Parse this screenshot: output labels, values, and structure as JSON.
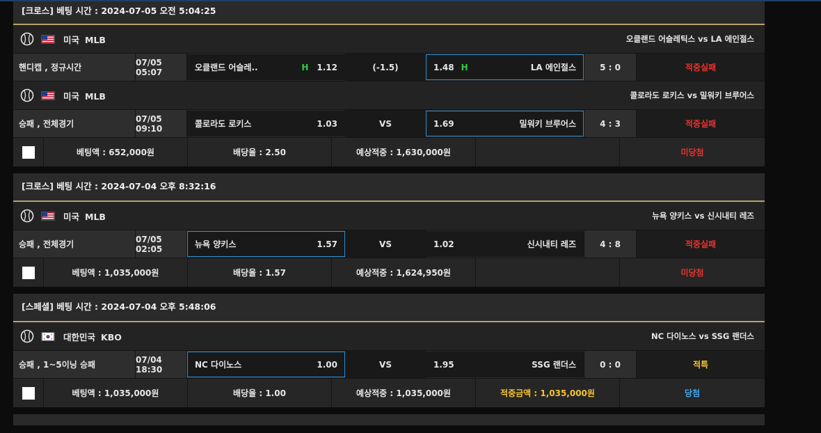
{
  "bets": [
    {
      "header": "[크로스] 베팅 시간 : 2024-07-05 오전 5:04:25",
      "games": [
        {
          "country": "미국",
          "league": "MLB",
          "flag": "us",
          "matchup": "오클랜드 어슬레틱스 vs LA 에인절스",
          "type": "핸디캡 , 정규시간",
          "time": "07/05 05:07",
          "home": "오클랜드 어슬레..",
          "home_mark": "H",
          "home_odds": "1.12",
          "mid": "(-1.5)",
          "away_odds": "1.48",
          "away_mark": "H",
          "away": "LA 에인절스",
          "score": "5 : 0",
          "result": "적중실패"
        },
        {
          "country": "미국",
          "league": "MLB",
          "flag": "us",
          "matchup": "콜로라도 로키스 vs 밀워키 브루어스",
          "type": "승패 , 전체경기",
          "time": "07/05 09:10",
          "home": "콜로라도 로키스",
          "home_odds": "1.03",
          "mid": "VS",
          "away_odds": "1.69",
          "away": "밀워키 브루어스",
          "score": "4 : 3",
          "result": "적중실패"
        }
      ],
      "summary": {
        "amount": "베팅액 : 652,000원",
        "rate": "배당율 : 2.50",
        "expected": "예상적중 : 1,630,000원",
        "status": "미당첨"
      }
    },
    {
      "header": "[크로스] 베팅 시간 : 2024-07-04 오후 8:32:16",
      "games": [
        {
          "country": "미국",
          "league": "MLB",
          "flag": "us",
          "matchup": "뉴욕 양키스 vs 신시내티 레즈",
          "type": "승패 , 전체경기",
          "time": "07/05 02:05",
          "home": "뉴욕 양키스",
          "home_odds": "1.57",
          "mid": "VS",
          "away_odds": "1.02",
          "away": "신시내티 레즈",
          "score": "4 : 8",
          "result": "적중실패"
        }
      ],
      "summary": {
        "amount": "베팅액 : 1,035,000원",
        "rate": "배당율 : 1.57",
        "expected": "예상적중 : 1,624,950원",
        "status": "미당첨"
      }
    },
    {
      "header": "[스페셜] 베팅 시간 : 2024-07-04 오후 5:48:06",
      "games": [
        {
          "country": "대한민국",
          "league": "KBO",
          "flag": "kr",
          "matchup": "NC 다이노스 vs SSG 랜더스",
          "type": "승패 , 1~5이닝 승패",
          "time": "07/04 18:30",
          "home": "NC 다이노스",
          "home_odds": "1.00",
          "mid": "VS",
          "away_odds": "1.95",
          "away": "SSG 랜더스",
          "score": "0 : 0",
          "result": "적특"
        }
      ],
      "summary": {
        "amount": "베팅액 : 1,035,000원",
        "rate": "배당율 : 1.00",
        "expected": "예상적중 : 1,035,000원",
        "win_amount": "적중금액 : 1,035,000원",
        "status": "당첨"
      }
    }
  ],
  "colors": {
    "fail": "#e8332d",
    "special": "#f4c430",
    "win": "#3fa9f5",
    "handicap_mark": "#2ecc40",
    "selected_border": "#2f8fd1",
    "header_underline": "#b8a26a"
  },
  "icons": {
    "sport": "baseball-icon",
    "flag_us": "us-flag-icon",
    "flag_kr": "kr-flag-icon"
  }
}
